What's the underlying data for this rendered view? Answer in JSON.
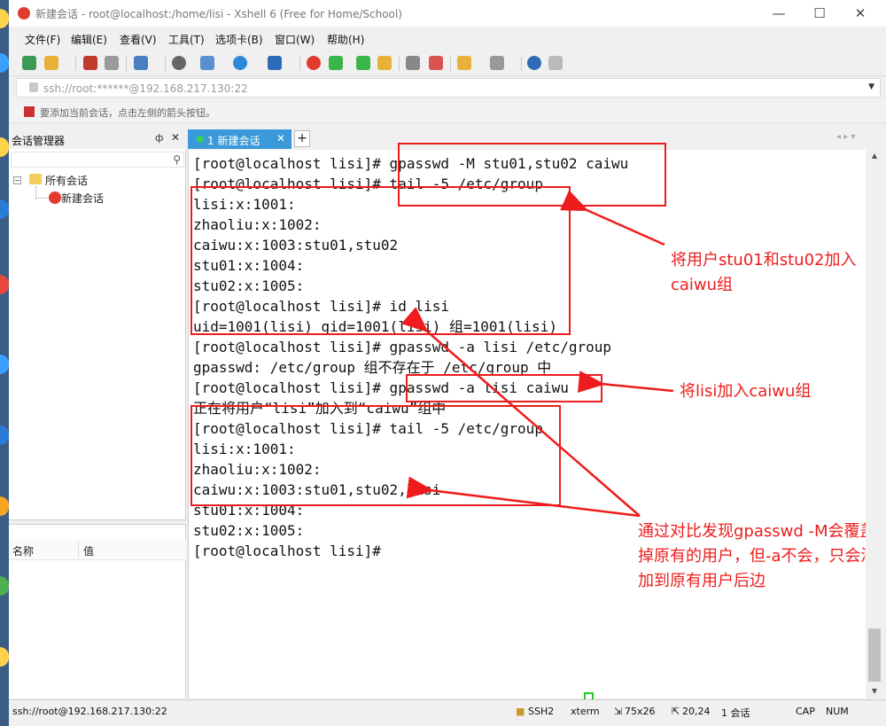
{
  "window": {
    "title": "新建会话 - root@localhost:/home/lisi - Xshell 6 (Free for Home/School)",
    "minimize": "—",
    "maximize": "☐",
    "close": "✕"
  },
  "menu": [
    "文件(F)",
    "编辑(E)",
    "查看(V)",
    "工具(T)",
    "选项卡(B)",
    "窗口(W)",
    "帮助(H)"
  ],
  "address_bar": {
    "value": "ssh://root:******@192.168.217.130:22"
  },
  "hint_bar": {
    "text": "要添加当前会话，点击左侧的箭头按钮。"
  },
  "session_manager": {
    "title": "会话管理器",
    "pin": "ф",
    "close": "✕",
    "tree": {
      "expander": "−",
      "root": "所有会话",
      "child": "新建会话"
    },
    "properties_headers": [
      "名称",
      "值"
    ]
  },
  "tabs": [
    {
      "label": "1 新建会话",
      "close": "✕"
    }
  ],
  "tab_add": "+",
  "tab_nav": "◂ ▸ ▾",
  "terminal": {
    "lines": [
      "[root@localhost lisi]# gpasswd -M stu01,stu02 caiwu",
      "[root@localhost lisi]# tail -5 /etc/group",
      "lisi:x:1001:",
      "zhaoliu:x:1002:",
      "caiwu:x:1003:stu01,stu02",
      "stu01:x:1004:",
      "stu02:x:1005:",
      "[root@localhost lisi]# id lisi",
      "uid=1001(lisi) gid=1001(lisi) 组=1001(lisi)",
      "[root@localhost lisi]# gpasswd -a lisi /etc/group",
      "gpasswd: /etc/group 组不存在于 /etc/group 中",
      "[root@localhost lisi]# gpasswd -a lisi caiwu",
      "正在将用户“lisi”加入到“caiwu”组中",
      "[root@localhost lisi]# tail -5 /etc/group",
      "lisi:x:1001:",
      "zhaoliu:x:1002:",
      "caiwu:x:1003:stu01,stu02,lisi",
      "stu01:x:1004:",
      "stu02:x:1005:",
      "[root@localhost lisi]# "
    ]
  },
  "annotations": [
    {
      "text": "将用户stu01和stu02加入caiwu组"
    },
    {
      "text": "将lisi加入caiwu组"
    },
    {
      "text": "通过对比发现gpasswd -M会覆盖掉原有的用户，但-a不会，只会添加到原有用户后边"
    }
  ],
  "status_bar": {
    "connection": "ssh://root@192.168.217.130:22",
    "protocol": "SSH2",
    "terminal_type": "xterm",
    "size": "75x26",
    "position": "20,24",
    "sessions": "1 会话",
    "caps": "CAP",
    "num": "NUM"
  },
  "colors": {
    "accent": "#3a9ad9",
    "annotation": "#ee1c1c",
    "cursor": "#22cc22"
  }
}
